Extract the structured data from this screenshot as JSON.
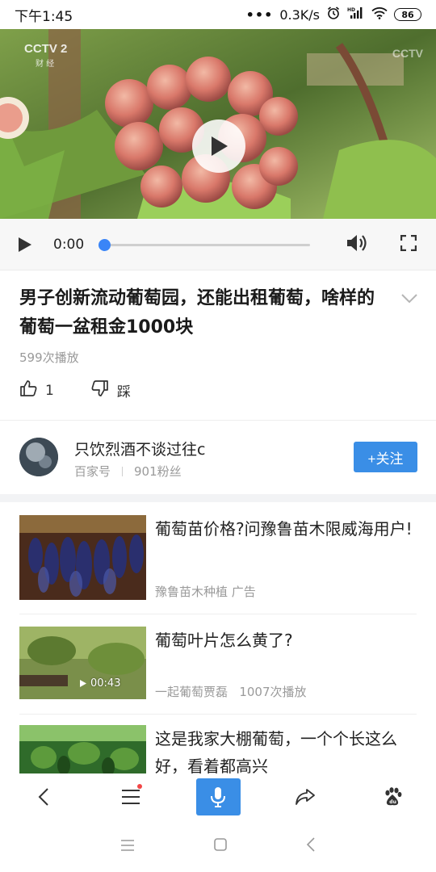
{
  "status_bar": {
    "time": "下午1:45",
    "network_speed": "0.3K/s",
    "battery": "86",
    "icons": [
      "more-dots-icon",
      "alarm-icon",
      "hd-signal-icon",
      "wifi-icon",
      "battery-icon"
    ]
  },
  "video": {
    "channel_logo": "CCTV 2",
    "channel_sub": "财 经",
    "watermark": "CCTV",
    "icon": "play-icon"
  },
  "player_controls": {
    "current_time": "0:00",
    "progress": 0,
    "icons": [
      "play-icon",
      "volume-icon",
      "fullscreen-icon"
    ],
    "accent_color": "#3a85f7"
  },
  "article": {
    "title": "男子创新流动葡萄园，还能出租葡萄，啥样的葡萄一盆租金1000块",
    "play_count": "599次播放",
    "like_count": "1",
    "dislike_label": "踩"
  },
  "author": {
    "name": "只饮烈酒不谈过往c",
    "platform": "百家号",
    "fans": "901粉丝",
    "follow_label": "+关注",
    "follow_color": "#3a8ee6"
  },
  "recommendations": [
    {
      "title": "葡萄苗价格?问豫鲁苗木限威海用户!",
      "source": "豫鲁苗木种植",
      "tag": "广告",
      "duration": "",
      "plays": ""
    },
    {
      "title": "葡萄叶片怎么黄了?",
      "source": "一起葡萄贾磊",
      "tag": "",
      "duration": "00:43",
      "plays": "1007次播放"
    },
    {
      "title": "这是我家大棚葡萄，一个个长这么好，看着都高兴",
      "source": "",
      "tag": "",
      "duration": "",
      "plays": ""
    }
  ],
  "toolbar": {
    "icons": [
      "back-icon",
      "menu-icon",
      "microphone-icon",
      "share-icon",
      "baidu-paw-icon"
    ],
    "mic_color": "#3a8ee6"
  },
  "nav_bar": {
    "icons": [
      "recent-apps-icon",
      "home-icon",
      "back-icon"
    ]
  }
}
